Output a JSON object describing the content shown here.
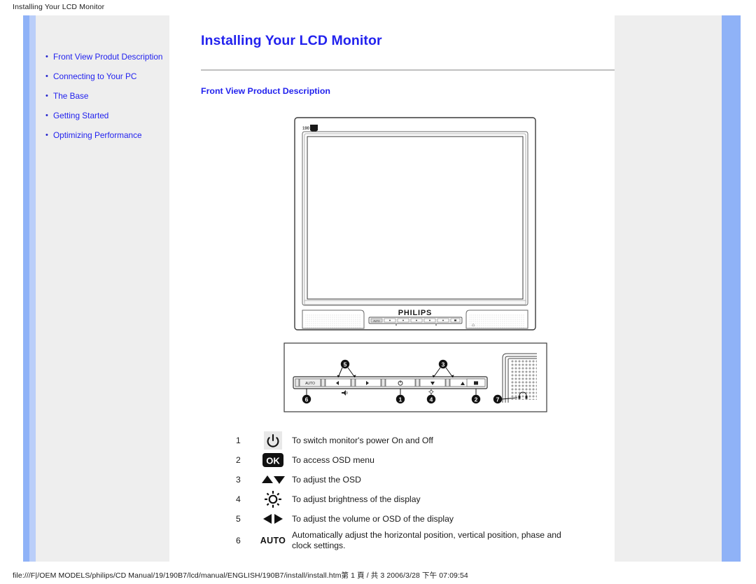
{
  "print_header": "Installing Your LCD Monitor",
  "print_footer": "file:///F|/OEM MODELS/philips/CD Manual/19/190B7/lcd/manual/ENGLISH/190B7/install/install.htm第 1 頁 / 共 3 2006/3/28 下午 07:09:54",
  "colors": {
    "link_blue": "#2222ee",
    "rail_blue": "#8fb2f7",
    "rail_blue_light": "#bacef9",
    "panel_grey": "#eeeeee",
    "divider_grey": "#c0c0c0",
    "text_black": "#1a1a1a"
  },
  "sidebar": {
    "bullet": "•",
    "items": [
      {
        "label": "Front View Produt Description"
      },
      {
        "label": "Connecting to Your PC"
      },
      {
        "label": "The Base"
      },
      {
        "label": "Getting Started"
      },
      {
        "label": "Optimizing Performance"
      }
    ]
  },
  "main": {
    "title": "Installing Your LCD Monitor",
    "section_title": "Front View Product Description",
    "monitor": {
      "model_label": "190B7",
      "brand": "PHILIPS"
    },
    "control_panel": {
      "auto_label": "AUTO",
      "callouts": [
        "1",
        "2",
        "3",
        "4",
        "5",
        "6",
        "7"
      ]
    },
    "legend": [
      {
        "num": "1",
        "icon": "power-icon",
        "text": "To switch monitor's power On and Off"
      },
      {
        "num": "2",
        "icon": "ok-icon",
        "text": "To access OSD menu"
      },
      {
        "num": "3",
        "icon": "up-down-arrows-icon",
        "text": "To adjust the OSD"
      },
      {
        "num": "4",
        "icon": "brightness-icon",
        "text": "To adjust brightness of the display"
      },
      {
        "num": "5",
        "icon": "left-right-arrows-icon",
        "text": "To adjust the volume or OSD of the display"
      },
      {
        "num": "6",
        "icon": "auto-text-icon",
        "icon_text": "AUTO",
        "text": "Automatically adjust the horizontal position, vertical position, phase and clock settings."
      }
    ]
  }
}
